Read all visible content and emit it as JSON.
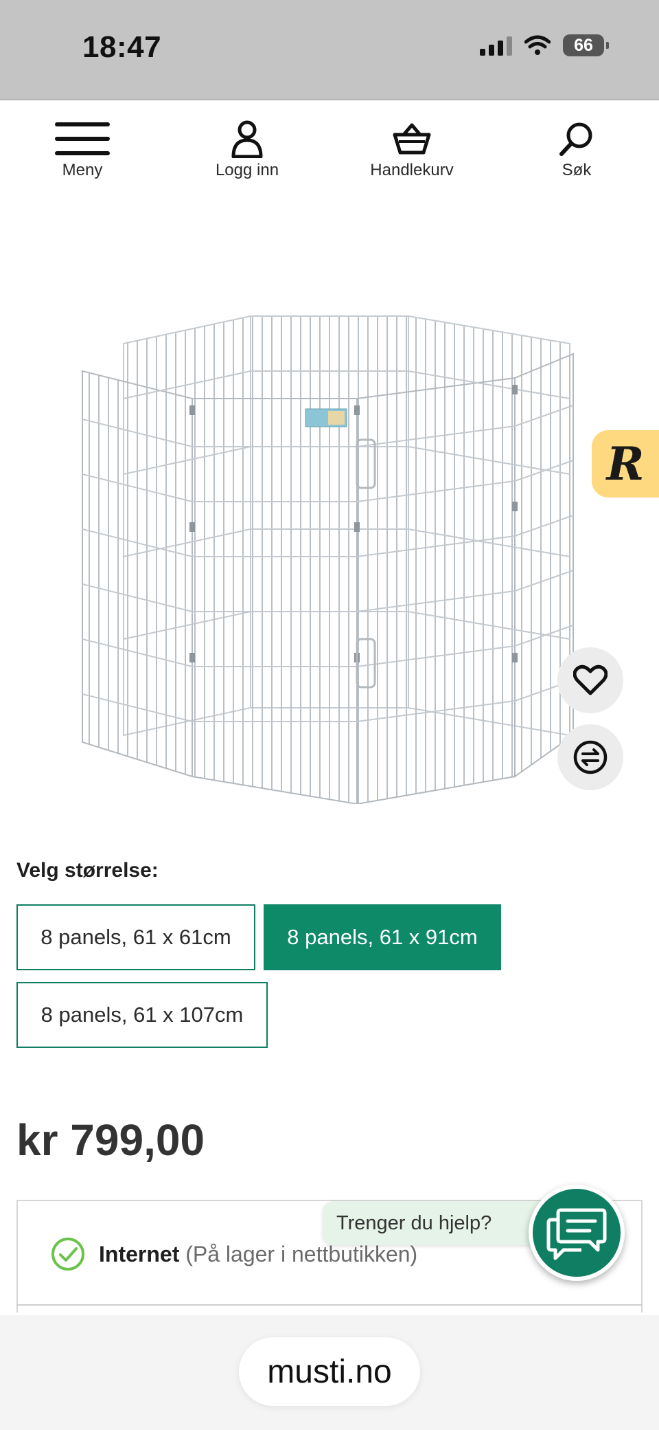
{
  "status_bar": {
    "time": "18:47",
    "battery": "66"
  },
  "nav": {
    "menu_label": "Meny",
    "login_label": "Logg inn",
    "cart_label": "Handlekurv",
    "search_label": "Søk"
  },
  "product": {
    "size_heading": "Velg størrelse:",
    "sizes": [
      {
        "label": "8 panels, 61 x 61cm",
        "selected": false
      },
      {
        "label": "8 panels, 61 x 91cm",
        "selected": true
      },
      {
        "label": "8 panels, 61 x 107cm",
        "selected": false
      }
    ],
    "price": "kr 799,00"
  },
  "stock": {
    "channel": "Internet",
    "status": "(På lager i nettbutikken)"
  },
  "help": {
    "label": "Trenger du hjelp?"
  },
  "review_badge": {
    "letter": "R"
  },
  "browser": {
    "url": "musti.no"
  },
  "colors": {
    "brand_green": "#0f8a68",
    "review_yellow": "#ffd980",
    "stock_check": "#6cc24a"
  }
}
